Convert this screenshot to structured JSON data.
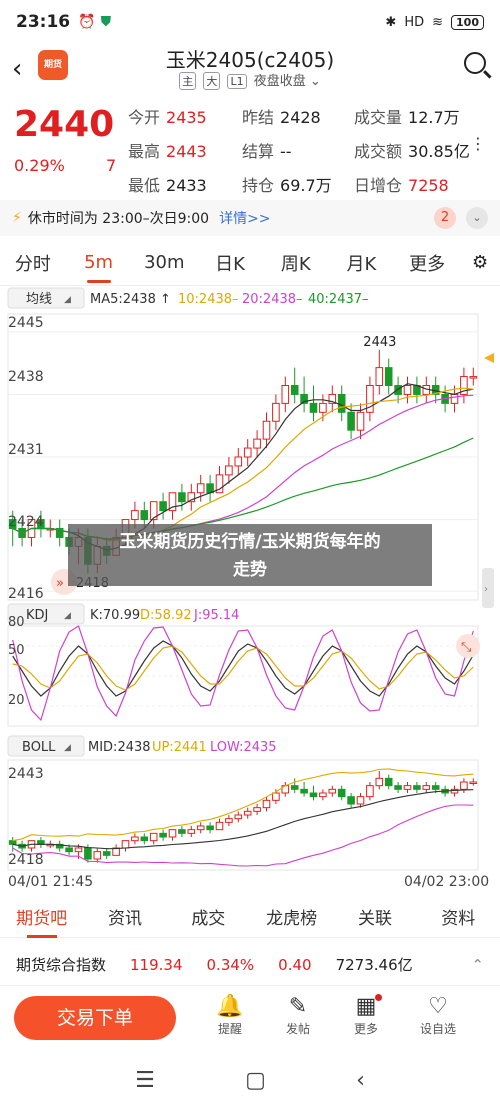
{
  "status": {
    "time": "23:16",
    "icons": [
      "⏰",
      "⛊"
    ],
    "right_icons": [
      "✱",
      "HD",
      "≋"
    ],
    "battery": "100"
  },
  "header": {
    "back_icon": "‹",
    "logo_text": "期货",
    "title": "玉米2405(c2405)",
    "tags": [
      "主",
      "大",
      "L1"
    ],
    "session": "夜盘收盘",
    "chevron": "⌄"
  },
  "quote": {
    "price": "2440",
    "pct": "0.29%",
    "change": "7",
    "fields": [
      {
        "k": "今开",
        "v": "2435",
        "red": true
      },
      {
        "k": "昨结",
        "v": "2428",
        "red": false
      },
      {
        "k": "成交量",
        "v": "12.7万",
        "red": false
      },
      {
        "k": "最高",
        "v": "2443",
        "red": true
      },
      {
        "k": "结算",
        "v": "--",
        "red": false
      },
      {
        "k": "成交额",
        "v": "30.85亿",
        "red": false
      },
      {
        "k": "最低",
        "v": "2433",
        "red": false
      },
      {
        "k": "持仓",
        "v": "69.7万",
        "red": false
      },
      {
        "k": "日增仓",
        "v": "7258",
        "red": true
      }
    ]
  },
  "notice": {
    "icon": "⚡",
    "text": "休市时间为 23:00–次日9:00",
    "link": "详情>>",
    "badge": "2",
    "expand": "⌄"
  },
  "tabs": [
    "分时",
    "5m",
    "30m",
    "日K",
    "周K",
    "月K",
    "更多"
  ],
  "active_tab": "5m",
  "legend_main": {
    "selector": "均线",
    "ma5": "MA5:2438 ↑",
    "ma10": "10:2438–",
    "ma20": "20:2438–",
    "ma40": "40:2437–"
  },
  "price_axis": [
    "2445",
    "2438",
    "2431",
    "2424",
    "2416"
  ],
  "annotations": {
    "high": "2443",
    "low": "2418"
  },
  "kdj": {
    "selector": "KDJ",
    "k": "K:70.99",
    "d": "D:58.92",
    "j": "J:95.14",
    "axis": [
      "80",
      "50",
      "20"
    ]
  },
  "boll": {
    "selector": "BOLL",
    "mid": "MID:2438",
    "up": "UP:2441",
    "low": "LOW:2435",
    "axis": [
      "2443",
      "2418"
    ]
  },
  "time_axis": {
    "start": "04/01 21:45",
    "end": "04/02 23:00"
  },
  "overlay": {
    "line1": "玉米期货历史行情/玉米期货每年的",
    "line2": "走势"
  },
  "bottom_tabs": [
    "期货吧",
    "资讯",
    "成交",
    "龙虎榜",
    "关联",
    "资料"
  ],
  "index_row": {
    "name": "期货综合指数",
    "value": "119.34",
    "pct": "0.34%",
    "change": "0.40",
    "amount": "7273.46亿",
    "caret": "⌃"
  },
  "actions": {
    "trade": "交易下单",
    "items": [
      {
        "icon": "🔔",
        "label": "提醒"
      },
      {
        "icon": "✎",
        "label": "发帖"
      },
      {
        "icon": "▦",
        "label": "更多"
      },
      {
        "icon": "♡",
        "label": "设自选"
      }
    ]
  },
  "nav": [
    "☰",
    "▢",
    "‹"
  ],
  "colors": {
    "up": "#e02020",
    "down": "#1a9a2a",
    "accent": "#f5512b",
    "ma5": "#333333",
    "ma10": "#e0a800",
    "ma20": "#d040d0",
    "ma40": "#1a9a2a"
  },
  "chart_data": [
    {
      "type": "candlestick",
      "title": "",
      "y_ticks": [
        2416,
        2424,
        2431,
        2438,
        2445
      ],
      "ylim": [
        2415,
        2447
      ],
      "high_label": 2443,
      "low_label": 2418,
      "ohlc": [
        [
          2424,
          2425,
          2421,
          2423
        ],
        [
          2423,
          2424,
          2421,
          2422
        ],
        [
          2422,
          2424,
          2421,
          2424
        ],
        [
          2424,
          2425,
          2422,
          2423
        ],
        [
          2423,
          2424,
          2422,
          2423
        ],
        [
          2423,
          2424,
          2421,
          2422
        ],
        [
          2422,
          2423,
          2420,
          2421
        ],
        [
          2421,
          2423,
          2419,
          2422
        ],
        [
          2422,
          2423,
          2418,
          2419
        ],
        [
          2419,
          2422,
          2418,
          2421
        ],
        [
          2421,
          2422,
          2419,
          2420
        ],
        [
          2420,
          2423,
          2420,
          2422
        ],
        [
          2422,
          2424,
          2421,
          2424
        ],
        [
          2424,
          2426,
          2423,
          2425
        ],
        [
          2425,
          2426,
          2423,
          2424
        ],
        [
          2424,
          2426,
          2423,
          2426
        ],
        [
          2426,
          2427,
          2424,
          2425
        ],
        [
          2425,
          2427,
          2424,
          2427
        ],
        [
          2427,
          2428,
          2425,
          2426
        ],
        [
          2426,
          2428,
          2425,
          2427
        ],
        [
          2427,
          2429,
          2426,
          2428
        ],
        [
          2428,
          2429,
          2426,
          2427
        ],
        [
          2427,
          2430,
          2427,
          2429
        ],
        [
          2429,
          2431,
          2428,
          2430
        ],
        [
          2430,
          2432,
          2429,
          2431
        ],
        [
          2431,
          2433,
          2430,
          2432
        ],
        [
          2432,
          2434,
          2431,
          2433
        ],
        [
          2433,
          2436,
          2432,
          2435
        ],
        [
          2435,
          2438,
          2434,
          2437
        ],
        [
          2437,
          2440,
          2436,
          2439
        ],
        [
          2439,
          2441,
          2437,
          2438
        ],
        [
          2438,
          2440,
          2436,
          2437
        ],
        [
          2437,
          2439,
          2435,
          2436
        ],
        [
          2436,
          2438,
          2435,
          2437
        ],
        [
          2437,
          2439,
          2436,
          2438
        ],
        [
          2438,
          2439,
          2435,
          2436
        ],
        [
          2436,
          2437,
          2433,
          2434
        ],
        [
          2434,
          2437,
          2433,
          2436
        ],
        [
          2436,
          2440,
          2435,
          2439
        ],
        [
          2439,
          2443,
          2438,
          2441
        ],
        [
          2441,
          2442,
          2438,
          2439
        ],
        [
          2439,
          2440,
          2437,
          2438
        ],
        [
          2438,
          2440,
          2437,
          2439
        ],
        [
          2439,
          2440,
          2437,
          2438
        ],
        [
          2438,
          2440,
          2437,
          2439
        ],
        [
          2439,
          2440,
          2437,
          2438
        ],
        [
          2438,
          2439,
          2436,
          2437
        ],
        [
          2437,
          2439,
          2436,
          2438
        ],
        [
          2438,
          2441,
          2437,
          2440
        ],
        [
          2440,
          2441,
          2439,
          2440
        ]
      ]
    },
    {
      "type": "line",
      "title": "",
      "y_ticks": [
        20,
        50,
        80
      ],
      "ylim": [
        0,
        100
      ],
      "series": [
        {
          "name": "K",
          "values": [
            70,
            55,
            40,
            30,
            38,
            55,
            70,
            80,
            72,
            55,
            40,
            30,
            35,
            50,
            65,
            78,
            85,
            80,
            68,
            52,
            40,
            35,
            45,
            60,
            75,
            82,
            78,
            65,
            50,
            38,
            32,
            40,
            55,
            70,
            80,
            75,
            60,
            45,
            35,
            30,
            42,
            58,
            72,
            80,
            74,
            60,
            48,
            42,
            55,
            71
          ]
        },
        {
          "name": "D",
          "values": [
            62,
            60,
            52,
            42,
            38,
            45,
            58,
            70,
            72,
            63,
            50,
            40,
            36,
            42,
            55,
            68,
            78,
            80,
            74,
            62,
            50,
            42,
            42,
            52,
            65,
            75,
            78,
            72,
            60,
            48,
            40,
            40,
            48,
            60,
            72,
            75,
            68,
            56,
            45,
            37,
            40,
            50,
            62,
            72,
            74,
            66,
            56,
            48,
            50,
            59
          ]
        },
        {
          "name": "J",
          "values": [
            86,
            45,
            16,
            6,
            38,
            75,
            94,
            100,
            72,
            39,
            20,
            10,
            33,
            66,
            85,
            98,
            99,
            80,
            56,
            32,
            20,
            21,
            51,
            76,
            95,
            96,
            78,
            51,
            30,
            18,
            16,
            40,
            69,
            90,
            96,
            75,
            44,
            23,
            15,
            16,
            46,
            74,
            92,
            96,
            74,
            48,
            32,
            30,
            65,
            95
          ]
        }
      ]
    },
    {
      "type": "candlestick",
      "title": "",
      "y_ticks": [
        2418,
        2443
      ],
      "ylim": [
        2416,
        2446
      ],
      "overlay_lines": [
        "MID",
        "UP",
        "LOW"
      ]
    }
  ]
}
